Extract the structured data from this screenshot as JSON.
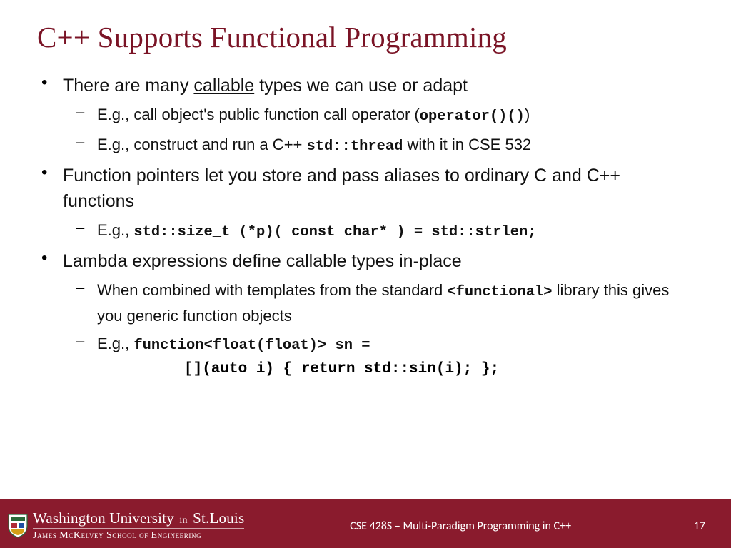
{
  "title": "C++ Supports Functional Programming",
  "bullets": {
    "b1": {
      "pre": "There are many ",
      "u": "callable",
      "post": " types we can use or adapt"
    },
    "b1s1": {
      "pre": "E.g., call object's public function call operator (",
      "code": "operator()()",
      "post": ")"
    },
    "b1s2": {
      "pre": "E.g., construct and run a C++ ",
      "code": "std::thread",
      "post": " with it in CSE 532"
    },
    "b2": "Function pointers let you store and pass aliases to ordinary C and C++ functions",
    "b2s1": {
      "pre": "E.g., ",
      "code": "std::size_t (*p)( const char* ) = std::strlen;"
    },
    "b3": "Lambda expressions define callable types in-place",
    "b3s1": {
      "pre": "When combined with templates from the standard ",
      "code": "<functional>",
      "post": " library this gives you generic function objects"
    },
    "b3s2": {
      "pre": "E.g., ",
      "code": "function<float(float)> sn ="
    },
    "b3s2b": "[](auto i) { return std::sin(i); };"
  },
  "footer": {
    "university_main": "Washington University",
    "university_in": "in",
    "university_city": "St.Louis",
    "school": "James McKelvey School of Engineering",
    "course": "CSE 428S – Multi-Paradigm Programming in C++",
    "page": "17"
  }
}
